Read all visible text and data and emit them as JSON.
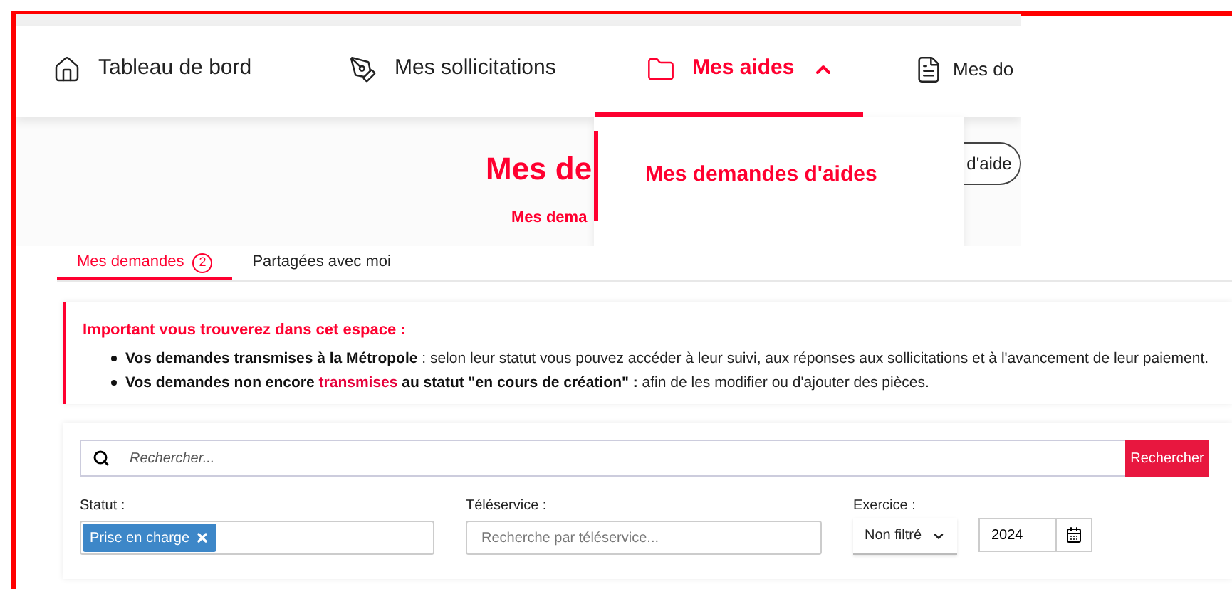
{
  "nav": {
    "items": [
      {
        "label": "Tableau de bord",
        "selected": false
      },
      {
        "label": "Mes sollicitations",
        "selected": false
      },
      {
        "label": "Mes aides",
        "selected": true,
        "expanded": true
      },
      {
        "label": "Mes do",
        "selected": false
      }
    ]
  },
  "dropdown": {
    "items": [
      {
        "label": "Mes demandes d'aides",
        "selected": true
      }
    ]
  },
  "page": {
    "title": "Mes de",
    "action_button": "d'aide",
    "subtitle": "Mes dema"
  },
  "tabs": [
    {
      "label": "Mes demandes",
      "count": "2",
      "selected": true
    },
    {
      "label": "Partagées avec moi",
      "selected": false
    }
  ],
  "notice": {
    "title": "Important vous trouverez dans cet espace :",
    "items": [
      [
        {
          "text": "Vos demandes transmises à la Métropole",
          "kind": "bold"
        },
        {
          "text": " : selon leur statut vous pouvez accéder à leur suivi, aux réponses aux sollicitations et à l'avancement de leur paiement.",
          "kind": "plain"
        }
      ],
      [
        {
          "text": "Vos demandes non encore ",
          "kind": "bold"
        },
        {
          "text": "transmises",
          "kind": "highlight"
        },
        {
          "text": " au statut \"en cours de création\" :",
          "kind": "bold"
        },
        {
          "text": " afin de les modifier ou d'ajouter des pièces.",
          "kind": "plain"
        }
      ]
    ]
  },
  "filters": {
    "search": {
      "placeholder": "Rechercher...",
      "button": "Rechercher"
    },
    "status": {
      "label": "Statut :",
      "chips": [
        "Prise en charge"
      ]
    },
    "teleservice": {
      "label": "Téléservice :",
      "placeholder": "Recherche par téléservice..."
    },
    "exercice": {
      "label": "Exercice :",
      "select": "Non filtré",
      "year": "2024"
    }
  }
}
